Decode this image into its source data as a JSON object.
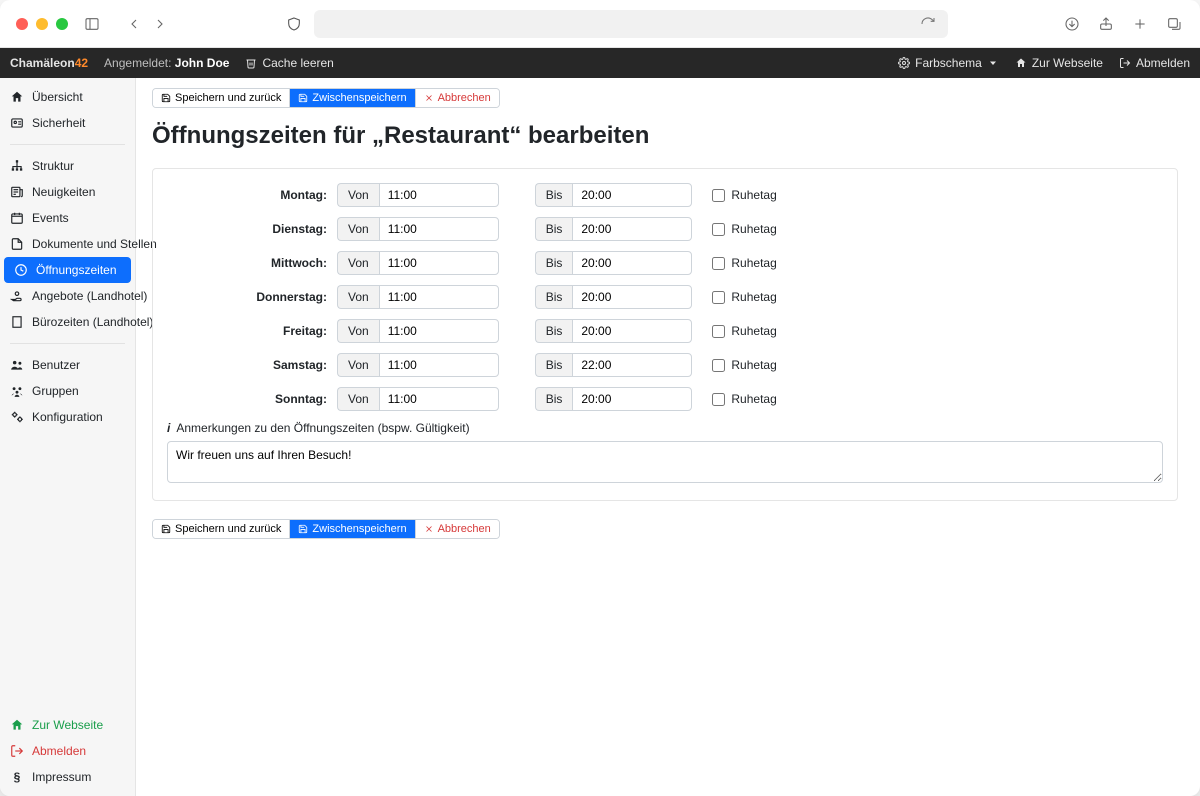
{
  "topbar": {
    "brand_a": "Chamäleon",
    "brand_b": "42",
    "logged_in_prefix": "Angemeldet:",
    "logged_in_user": "John Doe",
    "clear_cache": "Cache leeren",
    "color_scheme": "Farbschema",
    "to_website": "Zur Webseite",
    "logout": "Abmelden"
  },
  "sidebar": {
    "overview": "Übersicht",
    "security": "Sicherheit",
    "structure": "Struktur",
    "news": "Neuigkeiten",
    "events": "Events",
    "documents": "Dokumente und Stellen",
    "opening_hours": "Öffnungszeiten",
    "offers": "Angebote (Landhotel)",
    "office_hours": "Bürozeiten (Landhotel)",
    "users": "Benutzer",
    "groups": "Gruppen",
    "config": "Konfiguration",
    "to_website": "Zur Webseite",
    "logout": "Abmelden",
    "imprint": "Impressum"
  },
  "actions": {
    "save_back": "Speichern und zurück",
    "save_intermediate": "Zwischenspeichern",
    "cancel": "Abbrechen"
  },
  "page": {
    "title": "Öffnungszeiten für „Restaurant“ bearbeiten"
  },
  "labels": {
    "from": "Von",
    "to": "Bis",
    "restday": "Ruhetag",
    "notes_label": "Anmerkungen zu den Öffnungszeiten (bspw. Gültigkeit)",
    "notes_value": "Wir freuen uns auf Ihren Besuch!"
  },
  "days": [
    {
      "name": "Montag:",
      "from": "11:00",
      "to": "20:00"
    },
    {
      "name": "Dienstag:",
      "from": "11:00",
      "to": "20:00"
    },
    {
      "name": "Mittwoch:",
      "from": "11:00",
      "to": "20:00"
    },
    {
      "name": "Donnerstag:",
      "from": "11:00",
      "to": "20:00"
    },
    {
      "name": "Freitag:",
      "from": "11:00",
      "to": "20:00"
    },
    {
      "name": "Samstag:",
      "from": "11:00",
      "to": "22:00"
    },
    {
      "name": "Sonntag:",
      "from": "11:00",
      "to": "20:00"
    }
  ]
}
